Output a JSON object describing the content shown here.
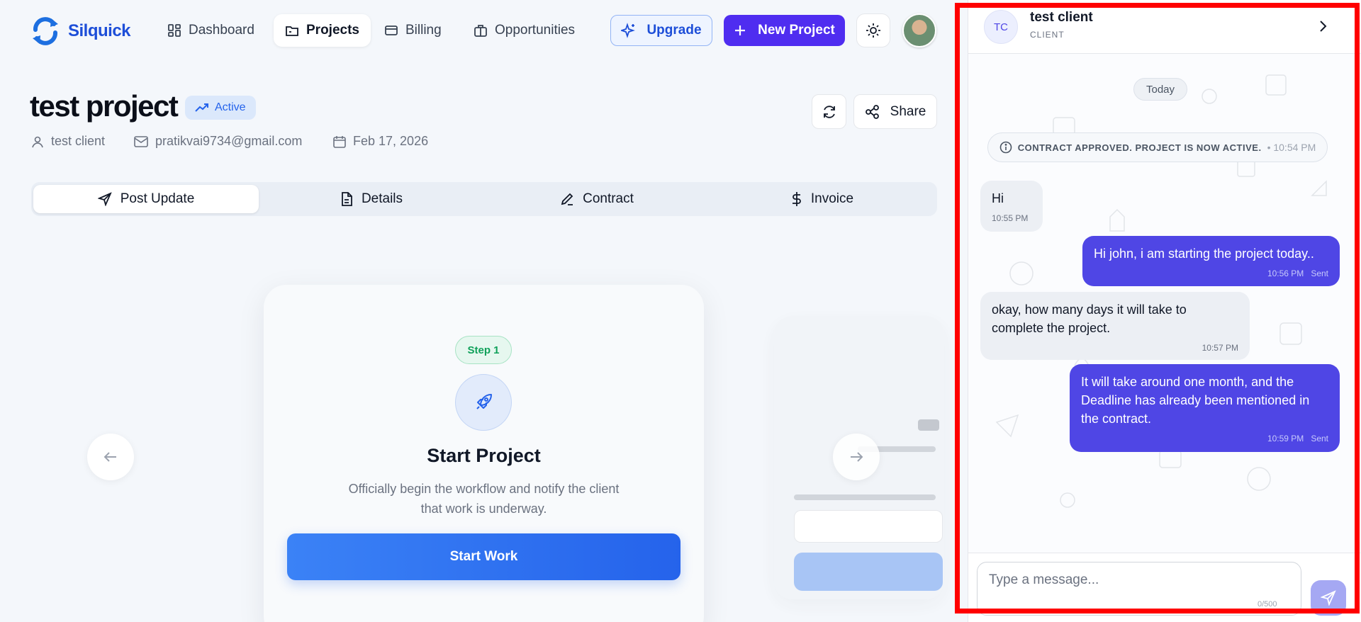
{
  "nav": {
    "logo": "Silquick",
    "items": [
      {
        "label": "Dashboard",
        "icon": "dashboard-icon"
      },
      {
        "label": "Projects",
        "icon": "folder-icon"
      },
      {
        "label": "Billing",
        "icon": "credit-card-icon"
      },
      {
        "label": "Opportunities",
        "icon": "briefcase-icon"
      }
    ],
    "upgrade_label": "Upgrade",
    "new_project_label": "New Project"
  },
  "project": {
    "title": "test project",
    "status": "Active",
    "client": "test client",
    "email": "pratikvai9734@gmail.com",
    "date": "Feb 17, 2026",
    "share_label": "Share"
  },
  "tabs": [
    {
      "label": "Post Update",
      "icon": "send-icon"
    },
    {
      "label": "Details",
      "icon": "document-icon"
    },
    {
      "label": "Contract",
      "icon": "pen-icon"
    },
    {
      "label": "Invoice",
      "icon": "dollar-icon"
    }
  ],
  "step_card": {
    "step": "Step 1",
    "title": "Start Project",
    "description": "Officially begin the workflow and notify the client that work is underway.",
    "button": "Start Work"
  },
  "chat": {
    "initials": "TC",
    "name": "test client",
    "role": "CLIENT",
    "day": "Today",
    "system_message": "CONTRACT APPROVED. PROJECT IS NOW ACTIVE.",
    "system_time": "• 10:54 PM",
    "messages": [
      {
        "dir": "in",
        "text": "Hi",
        "time": "10:55 PM",
        "status": ""
      },
      {
        "dir": "out",
        "text": "Hi john, i am starting the project today..",
        "time": "10:56 PM",
        "status": "Sent"
      },
      {
        "dir": "in",
        "text": "okay, how many days it will take to complete the project.",
        "time": "10:57 PM",
        "status": ""
      },
      {
        "dir": "out",
        "text": "It will take around one month, and the Deadline has already been mentioned in the contract.",
        "time": "10:59 PM",
        "status": "Sent"
      }
    ],
    "input_placeholder": "Type a message...",
    "char_count": "0/500"
  },
  "colors": {
    "brand": "#1d4ed8",
    "primary": "#4f2df0",
    "outgoing_bubble": "#4f46e5",
    "highlight_frame": "#ff0000"
  }
}
